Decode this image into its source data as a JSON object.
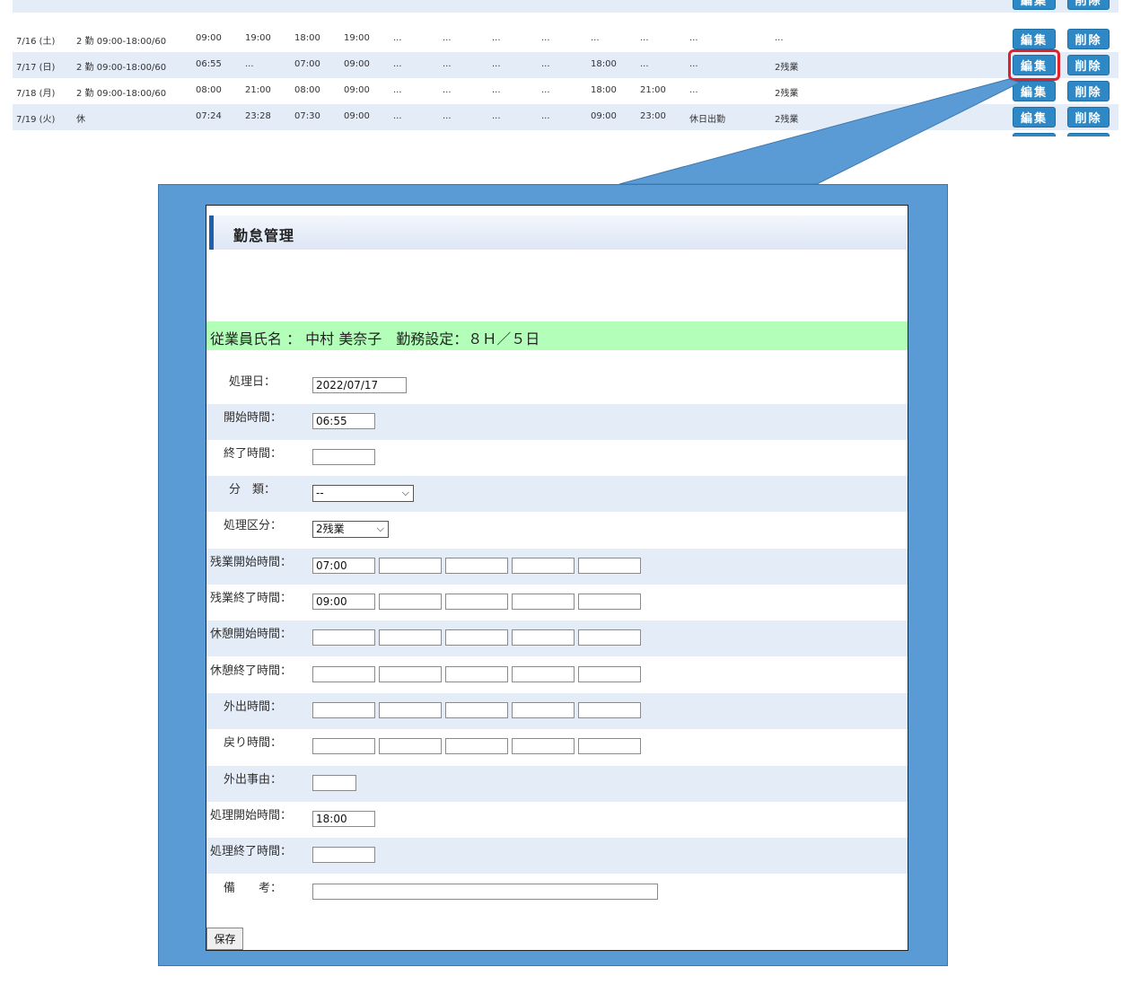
{
  "table": {
    "rows": [
      {
        "date": "7/16 (土)",
        "shift": "2 勤 09:00-18:00/60",
        "c1": "09:00",
        "c2": "19:00",
        "c3": "18:00",
        "c4": "19:00",
        "c5": "...",
        "c6": "...",
        "c7": "...",
        "c8": "...",
        "c9": "...",
        "c10": "...",
        "c11": "...",
        "c12": "..."
      },
      {
        "date": "7/17 (日)",
        "shift": "2 勤 09:00-18:00/60",
        "c1": "06:55",
        "c2": "...",
        "c3": "07:00",
        "c4": "09:00",
        "c5": "...",
        "c6": "...",
        "c7": "...",
        "c8": "...",
        "c9": "18:00",
        "c10": "...",
        "c11": "...",
        "c12": "2残業"
      },
      {
        "date": "7/18 (月)",
        "shift": "2 勤 09:00-18:00/60",
        "c1": "08:00",
        "c2": "21:00",
        "c3": "08:00",
        "c4": "09:00",
        "c5": "...",
        "c6": "...",
        "c7": "...",
        "c8": "...",
        "c9": "18:00",
        "c10": "21:00",
        "c11": "...",
        "c12": "2残業"
      },
      {
        "date": "7/19 (火)",
        "shift": "休",
        "c1": "07:24",
        "c2": "23:28",
        "c3": "07:30",
        "c4": "09:00",
        "c5": "...",
        "c6": "...",
        "c7": "...",
        "c8": "...",
        "c9": "09:00",
        "c10": "23:00",
        "c11": "休日出勤",
        "c12": "2残業"
      }
    ],
    "edit_label": "編集",
    "delete_label": "削除"
  },
  "dialog": {
    "title": "勤怠管理",
    "employee_line": "従業員氏名 ： 中村 美奈子　勤務設定：８Ｈ／５日",
    "save_label": "保存",
    "fields": {
      "date_label": "処理日：",
      "date_value": "2022/07/17",
      "start_label": "開始時間：",
      "start_value": "06:55",
      "end_label": "終了時間：",
      "end_value": "",
      "category_label": "分　類：",
      "category_value": "--",
      "type_label": "処理区分：",
      "type_value": "2残業",
      "ot_start_label": "残業開始時間：",
      "ot_start_value": "07:00",
      "ot_end_label": "残業終了時間：",
      "ot_end_value": "09:00",
      "break_start_label": "休憩開始時間：",
      "break_end_label": "休憩終了時間：",
      "out_label": "外出時間：",
      "return_label": "戻り時間：",
      "out_reason_label": "外出事由：",
      "proc_start_label": "処理開始時間：",
      "proc_start_value": "18:00",
      "proc_end_label": "処理終了時間：",
      "note_label": "備　　考："
    }
  }
}
